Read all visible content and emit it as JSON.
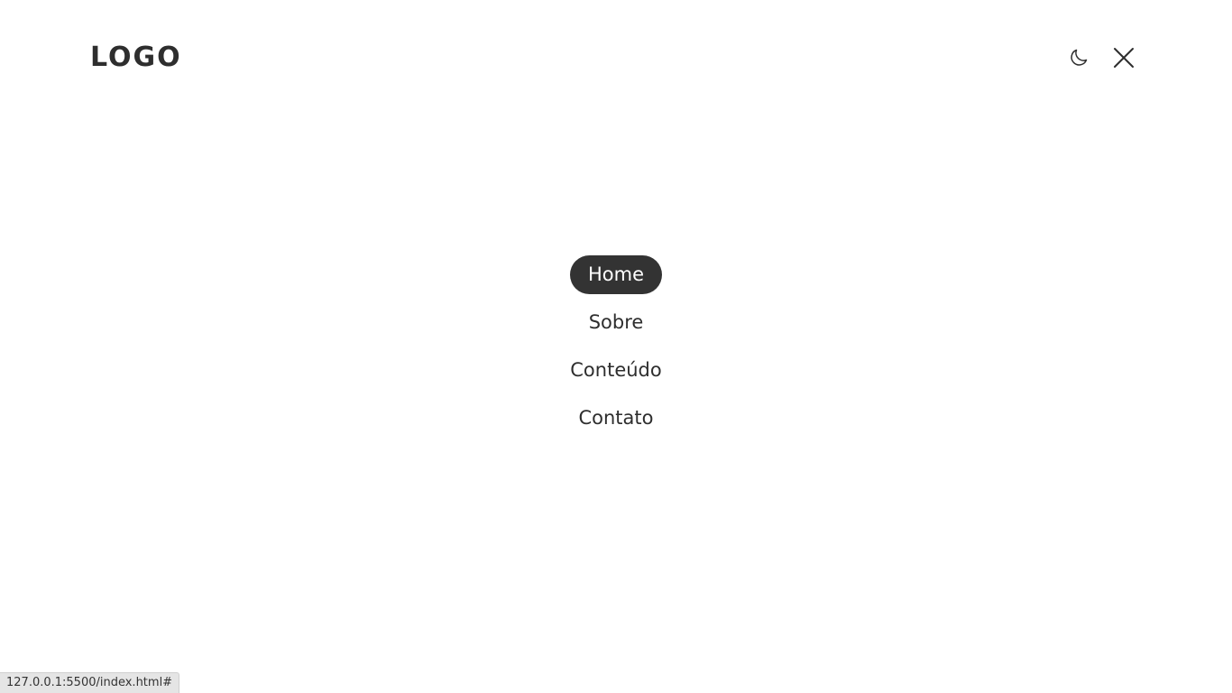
{
  "header": {
    "logo_text": "LOGO",
    "theme_toggle_icon": "moon-icon",
    "close_icon": "close-icon"
  },
  "nav": {
    "items": [
      {
        "label": "Home",
        "active": true
      },
      {
        "label": "Sobre",
        "active": false
      },
      {
        "label": "Conteúdo",
        "active": false
      },
      {
        "label": "Contato",
        "active": false
      }
    ]
  },
  "status_bar": {
    "url": "127.0.0.1:5500/index.html#"
  },
  "colors": {
    "text": "#2e2e2e",
    "active_bg": "#333333",
    "active_text": "#ffffff",
    "background": "#ffffff"
  }
}
